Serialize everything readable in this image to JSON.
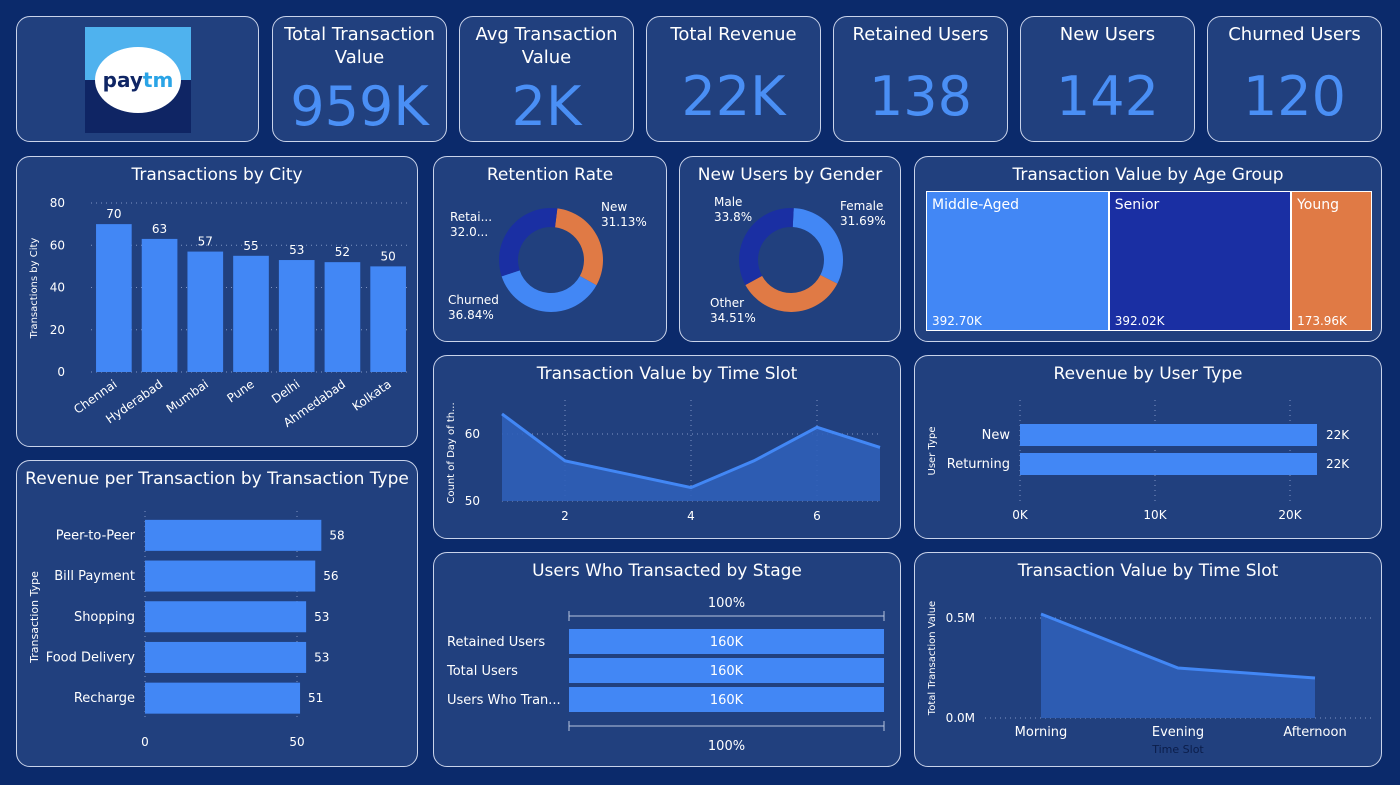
{
  "logo": {
    "pay": "pay",
    "tm": "tm"
  },
  "kpis": [
    {
      "title": "Total Transaction Value",
      "value": "959K"
    },
    {
      "title": "Avg Transaction Value",
      "value": "2K"
    },
    {
      "title": "Total Revenue",
      "value": "22K"
    },
    {
      "title": "Retained Users",
      "value": "138"
    },
    {
      "title": "New Users",
      "value": "142"
    },
    {
      "title": "Churned Users",
      "value": "120"
    }
  ],
  "panels": {
    "city": "Transactions by City",
    "retention": "Retention Rate",
    "gender": "New Users by Gender",
    "age": "Transaction Value by Age Group",
    "revpertx": "Revenue per Transaction by Transaction Type",
    "timeslot1": "Transaction Value by Time Slot",
    "usertype": "Revenue by User Type",
    "stage": "Users Who Transacted by Stage",
    "timeslot2": "Transaction Value by Time Slot"
  },
  "colors": {
    "blue": "#4287f5",
    "navy": "#1a2fa3",
    "orange": "#e07a45",
    "bg": "#0b2a6b",
    "card": "#21407e"
  },
  "chart_data": [
    {
      "id": "city",
      "type": "bar",
      "categories": [
        "Chennai",
        "Hyderabad",
        "Mumbai",
        "Pune",
        "Delhi",
        "Ahmedabad",
        "Kolkata"
      ],
      "values": [
        70,
        63,
        57,
        55,
        53,
        52,
        50
      ],
      "ylabel": "Transactions by City",
      "yticks": [
        "0",
        "20",
        "40",
        "60",
        "80"
      ],
      "ylim": [
        0,
        80
      ]
    },
    {
      "id": "retention",
      "type": "pie",
      "slices": [
        {
          "label": "New",
          "pct": "31.13%",
          "value": 31.13,
          "color": "#e07a45"
        },
        {
          "label": "Churned",
          "pct": "36.84%",
          "value": 36.84,
          "color": "#4287f5"
        },
        {
          "label": "Retai...",
          "pct": "32.0...",
          "value": 32.03,
          "color": "#1a2fa3"
        }
      ]
    },
    {
      "id": "gender",
      "type": "pie",
      "slices": [
        {
          "label": "Female",
          "pct": "31.69%",
          "value": 31.69,
          "color": "#4287f5"
        },
        {
          "label": "Other",
          "pct": "34.51%",
          "value": 34.51,
          "color": "#e07a45"
        },
        {
          "label": "Male",
          "pct": "33.8%",
          "value": 33.8,
          "color": "#1a2fa3"
        }
      ]
    },
    {
      "id": "age",
      "type": "treemap",
      "cells": [
        {
          "label": "Middle-Aged",
          "value": 392.7,
          "display": "392.70K",
          "color": "#4287f5"
        },
        {
          "label": "Senior",
          "value": 392.02,
          "display": "392.02K",
          "color": "#1a2fa3"
        },
        {
          "label": "Young",
          "value": 173.96,
          "display": "173.96K",
          "color": "#e07a45"
        }
      ]
    },
    {
      "id": "revpertx",
      "type": "bar",
      "orientation": "horizontal",
      "categories": [
        "Peer-to-Peer",
        "Bill Payment",
        "Shopping",
        "Food Delivery",
        "Recharge"
      ],
      "values": [
        58,
        56,
        53,
        53,
        51
      ],
      "ylabel": "Transaction Type",
      "xticks": [
        "0",
        "50"
      ],
      "xlim": [
        0,
        60
      ]
    },
    {
      "id": "timeslot1",
      "type": "area",
      "x": [
        1,
        2,
        3,
        4,
        5,
        6,
        7
      ],
      "values": [
        63,
        56,
        54,
        52,
        56,
        61,
        58
      ],
      "ylabel": "Count of Day of th...",
      "xticks": [
        "2",
        "4",
        "6"
      ],
      "yticks": [
        "50",
        "60"
      ],
      "ylim": [
        50,
        65
      ]
    },
    {
      "id": "usertype",
      "type": "bar",
      "orientation": "horizontal",
      "categories": [
        "New",
        "Returning"
      ],
      "values": [
        22,
        22
      ],
      "labels": [
        "22K",
        "22K"
      ],
      "ylabel": "User Type",
      "xticks": [
        "0K",
        "10K",
        "20K"
      ],
      "xlim": [
        0,
        22
      ]
    },
    {
      "id": "stage",
      "type": "funnel",
      "top_label": "100%",
      "bottom_label": "100%",
      "categories": [
        "Retained Users",
        "Total Users",
        "Users Who Tran..."
      ],
      "values": [
        160,
        160,
        160
      ],
      "labels": [
        "160K",
        "160K",
        "160K"
      ]
    },
    {
      "id": "timeslot2",
      "type": "area",
      "categories": [
        "Morning",
        "Evening",
        "Afternoon"
      ],
      "values": [
        0.52,
        0.25,
        0.2
      ],
      "ylabel": "Total Transaction Value",
      "xlabel": "Time Slot",
      "yticks": [
        "0.0M",
        "0.5M"
      ],
      "ylim": [
        0,
        0.6
      ]
    }
  ]
}
